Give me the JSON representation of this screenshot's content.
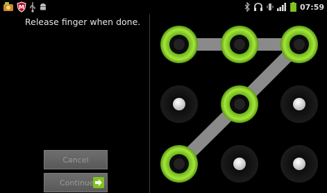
{
  "status_bar": {
    "left_icons": [
      "app-icon",
      "shield-icon",
      "usb-icon",
      "android-icon"
    ],
    "right_icons": [
      "bluetooth-icon",
      "headphones-icon",
      "vibrate-icon",
      "signal-icon",
      "battery-icon"
    ],
    "time": "07:59"
  },
  "instruction": "Release finger when done.",
  "buttons": {
    "cancel": "Cancel",
    "continue": "Continue"
  },
  "pattern": {
    "grid": "3x3",
    "selected_sequence": [
      1,
      2,
      3,
      5,
      7
    ],
    "colors": {
      "selected_ring": "#8fd42a",
      "line": "#8a8a8a",
      "dot_idle": "#dcdcdc",
      "ring_idle": "#1a1a1a"
    }
  }
}
